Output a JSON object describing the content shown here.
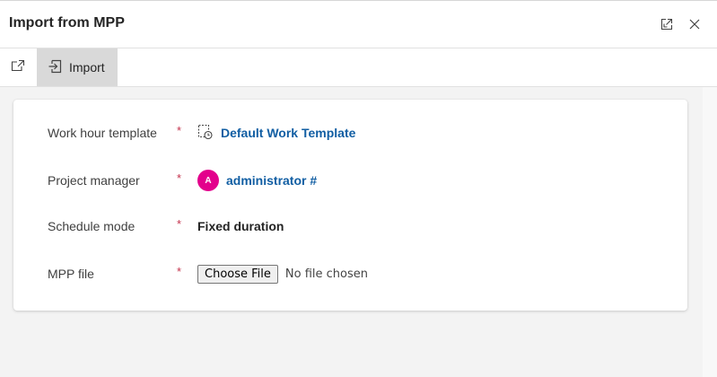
{
  "dialog": {
    "title": "Import from MPP",
    "expand_icon": "expand-icon",
    "close_icon": "close-icon"
  },
  "toolbar": {
    "popout_icon": "pop-out-icon",
    "import_icon": "import-icon",
    "import_label": "Import"
  },
  "form": {
    "required_marker": "*",
    "work_hour_template": {
      "label": "Work hour template",
      "icon": "calendar-clock-icon",
      "value": "Default Work Template"
    },
    "project_manager": {
      "label": "Project manager",
      "avatar_initial": "A",
      "value": "administrator #"
    },
    "schedule_mode": {
      "label": "Schedule mode",
      "value": "Fixed duration"
    },
    "mpp_file": {
      "label": "MPP file",
      "button_label": "Choose File",
      "status": "No file chosen"
    }
  },
  "colors": {
    "link": "#115ea3",
    "required": "#c4314b",
    "avatar": "#e3008c",
    "toolbar_active": "#d9d9d9"
  }
}
